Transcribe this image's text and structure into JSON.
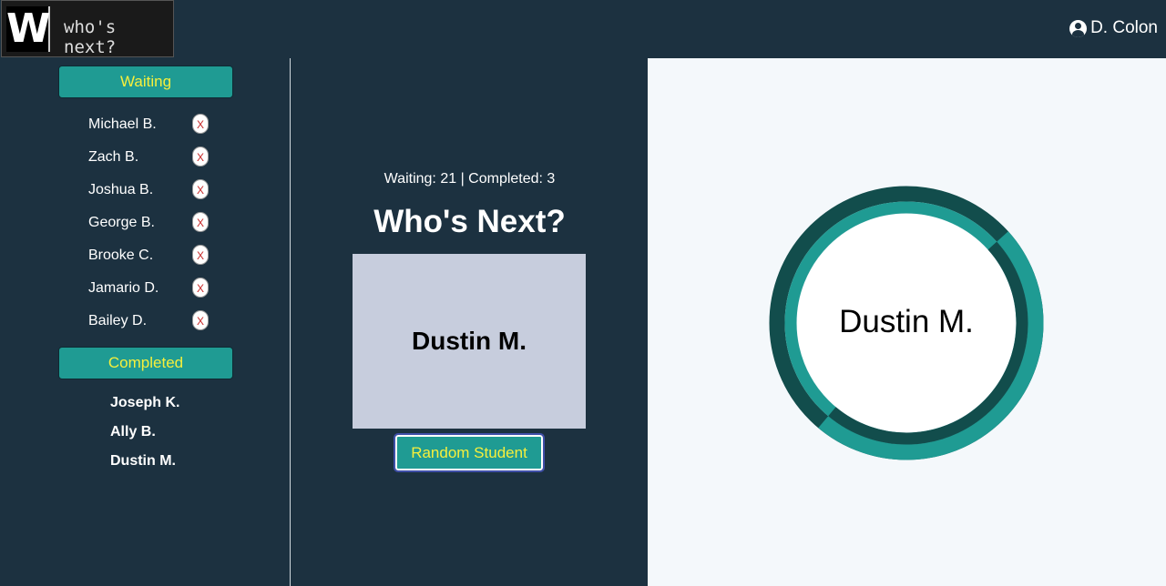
{
  "header": {
    "logo_letter": "W",
    "logo_text": "who's next?",
    "user_name": "D. Colon",
    "user_icon": "user-circle-icon"
  },
  "sidebar": {
    "waiting_label": "Waiting",
    "completed_label": "Completed",
    "remove_label": "X",
    "waiting": [
      "Michael B.",
      "Zach B.",
      "Joshua B.",
      "George B.",
      "Brooke C.",
      "Jamario D.",
      "Bailey D."
    ],
    "completed": [
      "Joseph K.",
      "Ally B.",
      "Dustin M."
    ]
  },
  "main": {
    "counts": "Waiting: 21 | Completed: 3",
    "title": "Who's Next?",
    "selected_name": "Dustin M.",
    "random_button": "Random Student"
  },
  "wheel": {
    "label": "Dustin M.",
    "colors": {
      "dark": "#124d4c",
      "teal": "#1f9b93",
      "center": "#ffffff"
    }
  }
}
